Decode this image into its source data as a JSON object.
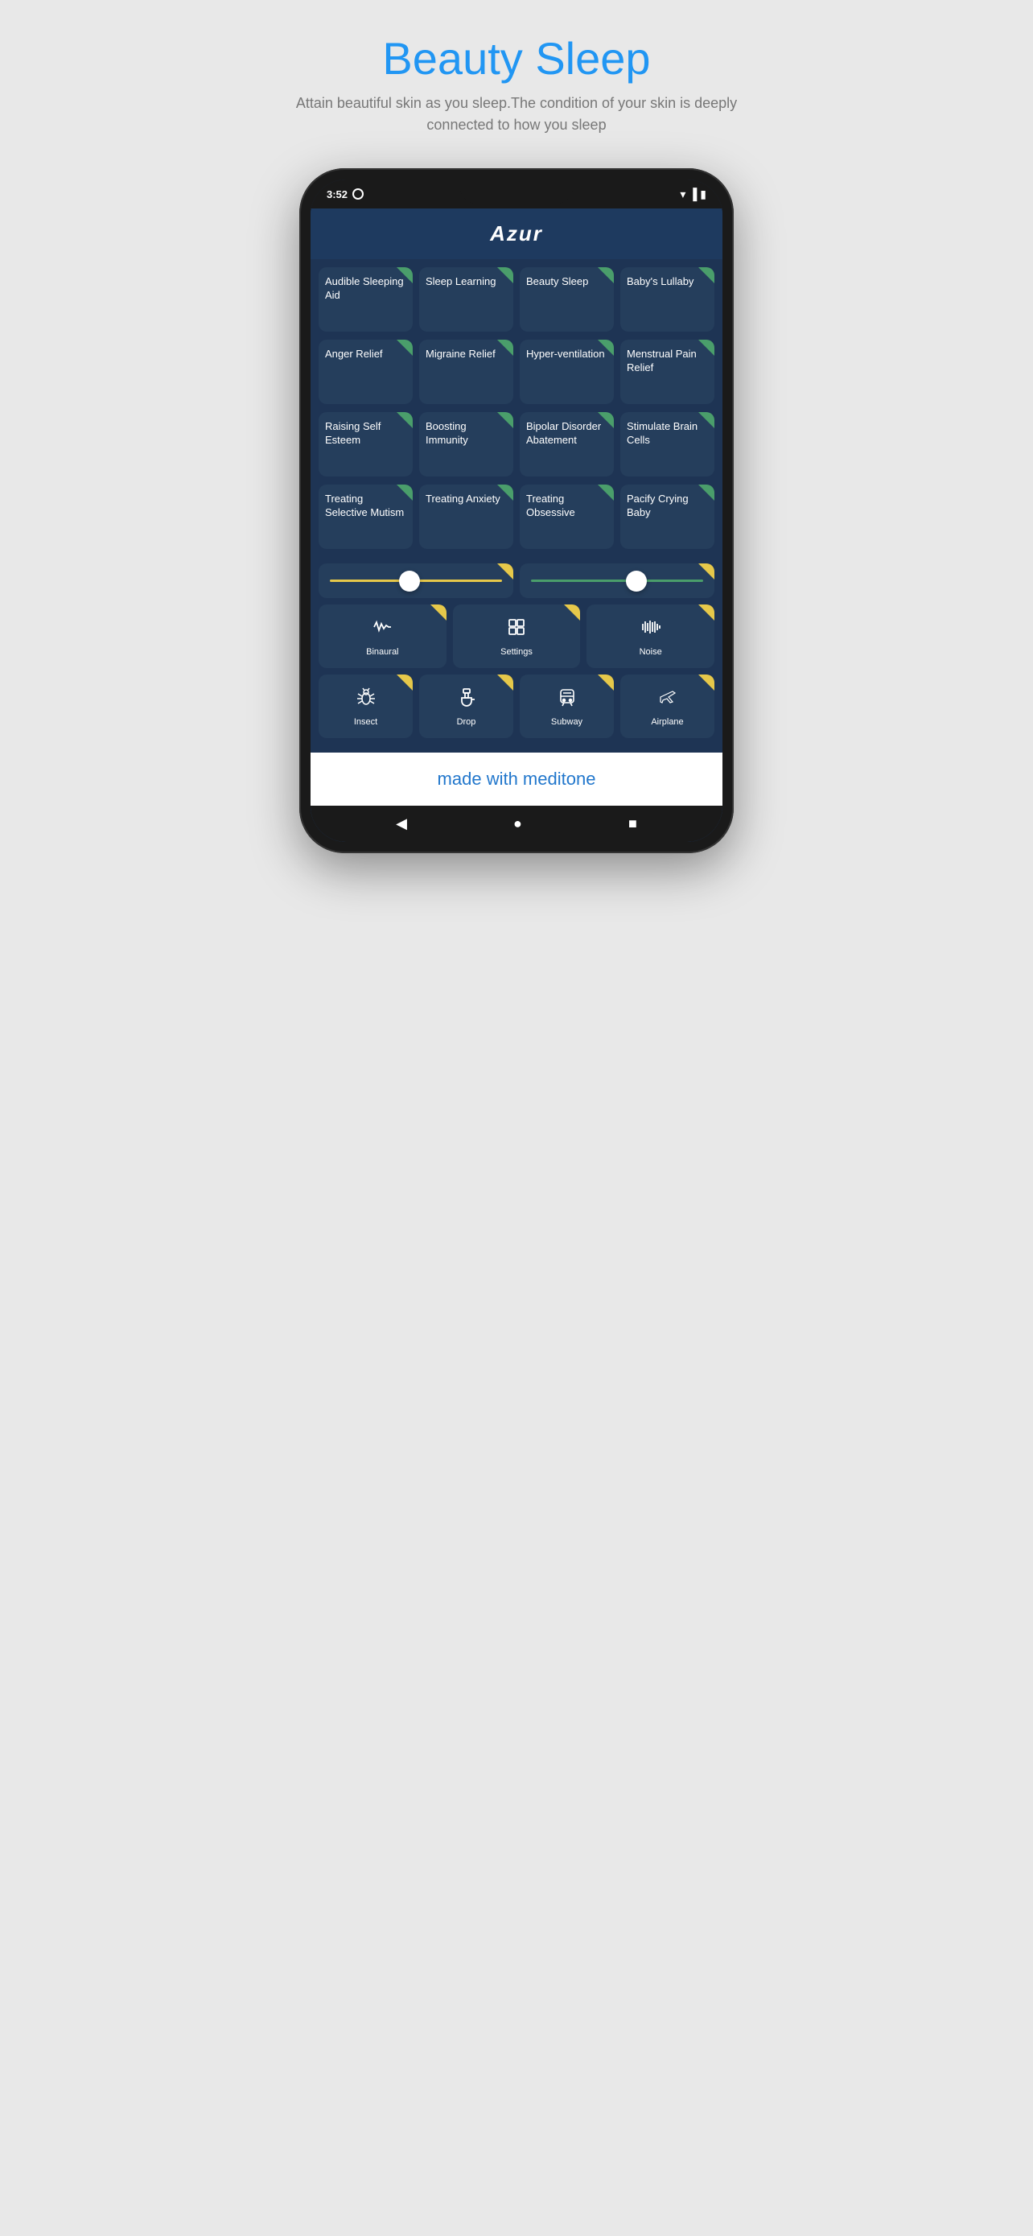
{
  "page": {
    "title_black": "Beauty",
    "title_blue": "Sleep",
    "subtitle": "Attain beautiful skin as you sleep.The condition of your skin is deeply connected to how you sleep"
  },
  "phone": {
    "status_time": "3:52",
    "app_name": "Azur"
  },
  "grid_row1": [
    {
      "label": "Audible Sleeping Aid",
      "corner": true
    },
    {
      "label": "Sleep Learning",
      "corner": true
    },
    {
      "label": "Beauty Sleep",
      "corner": true
    },
    {
      "label": "Baby's Lullaby",
      "corner": true
    }
  ],
  "grid_row2": [
    {
      "label": "Anger Relief",
      "corner": true
    },
    {
      "label": "Migraine Relief",
      "corner": true
    },
    {
      "label": "Hyper-ventilation",
      "corner": true
    },
    {
      "label": "Menstrual Pain Relief",
      "corner": true
    }
  ],
  "grid_row3": [
    {
      "label": "Raising Self Esteem",
      "corner": true
    },
    {
      "label": "Boosting Immunity",
      "corner": true
    },
    {
      "label": "Bipolar Disorder Abatement",
      "corner": true
    },
    {
      "label": "Stimulate Brain Cells",
      "corner": true
    }
  ],
  "grid_row4": [
    {
      "label": "Treating Selective Mutism",
      "corner": true
    },
    {
      "label": "Treating Anxiety",
      "corner": true
    },
    {
      "label": "Treating Obsessive",
      "corner": true
    },
    {
      "label": "Pacify Crying Baby",
      "corner": true
    }
  ],
  "icon_row1": [
    {
      "label": "Binaural",
      "icon": "binaural"
    },
    {
      "label": "Settings",
      "icon": "settings"
    },
    {
      "label": "Noise",
      "icon": "noise"
    }
  ],
  "icon_row2": [
    {
      "label": "Insect",
      "icon": "insect"
    },
    {
      "label": "Drop",
      "icon": "drop"
    },
    {
      "label": "Subway",
      "icon": "subway"
    },
    {
      "label": "Airplane",
      "icon": "airplane"
    }
  ],
  "footer": {
    "text": "made with meditone"
  },
  "nav": {
    "back": "◀",
    "home": "●",
    "recents": "■"
  }
}
